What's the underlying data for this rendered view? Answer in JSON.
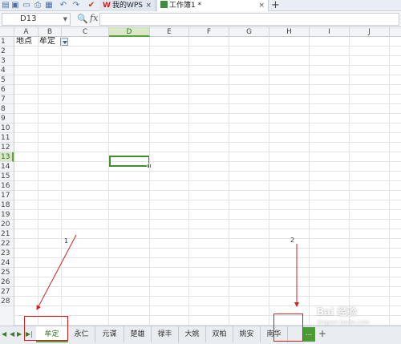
{
  "tabs": {
    "wps_label": "我的WPS",
    "book_label": "工作簿1 *",
    "close": "×",
    "new_tab": "+"
  },
  "formula_bar": {
    "name_box": "D13",
    "fx": "fx",
    "value": ""
  },
  "columns": [
    "A",
    "B",
    "C",
    "D",
    "E",
    "F",
    "G",
    "H",
    "I",
    "J"
  ],
  "active_column": "D",
  "rows": [
    "1",
    "2",
    "3",
    "4",
    "5",
    "6",
    "7",
    "8",
    "9",
    "10",
    "11",
    "12",
    "13",
    "14",
    "15",
    "16",
    "17",
    "18",
    "19",
    "20",
    "21",
    "22",
    "23",
    "24",
    "25",
    "26",
    "27",
    "28"
  ],
  "active_row": "13",
  "cells": {
    "a1": "地点",
    "b1": "牟定"
  },
  "selected_cell": "D13",
  "sheets": [
    "牟定",
    "永仁",
    "元谋",
    "楚雄",
    "禄丰",
    "大姚",
    "双柏",
    "姚安",
    "南华"
  ],
  "active_sheet": "牟定",
  "more_sheets": "...",
  "add_sheet": "+",
  "annotations": {
    "label_1": "1",
    "label_2": "2",
    "color": "#d3201f"
  },
  "watermark": {
    "text": "Bai 经验",
    "url": "jingyan.baidu.com"
  },
  "colors": {
    "accent_green": "#4fa33a",
    "wps_red": "#d51a1a"
  }
}
